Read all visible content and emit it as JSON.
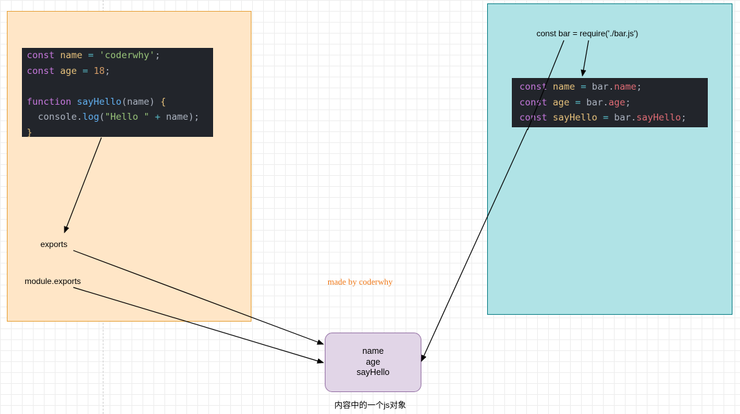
{
  "left_code": {
    "line1": {
      "kw": "const",
      "var": "name",
      "op": "=",
      "val": "'coderwhy'",
      "end": ";"
    },
    "line2": {
      "kw": "const",
      "var": "age",
      "op": "=",
      "val": "18",
      "end": ";"
    },
    "line4": {
      "kw": "function",
      "fn": "sayHello",
      "params": "(name)",
      "brace": "{"
    },
    "line5": {
      "obj": "console",
      "dot": ".",
      "method": "log",
      "open": "(",
      "str": "\"Hello \"",
      "op": "+",
      "arg": "name",
      "close": ");"
    },
    "line6": {
      "brace": "}"
    }
  },
  "right_code": {
    "line1": {
      "kw": "const",
      "var": "name",
      "op": "=",
      "obj": "bar.",
      "prop": "name",
      "end": ";"
    },
    "line2": {
      "kw": "const",
      "var": "age",
      "op": "=",
      "obj": "bar.",
      "prop": "age",
      "end": ";"
    },
    "line3": {
      "kw": "const",
      "var": "sayHello",
      "op": "=",
      "obj": "bar.",
      "prop": "sayHello",
      "end": ";"
    }
  },
  "labels": {
    "exports": "exports",
    "module_exports": "module.exports",
    "require": "const bar = require('./bar.js')",
    "watermark": "made by coderwhy",
    "object_caption": "内容中的一个js对象"
  },
  "object": {
    "props": [
      "name",
      "age",
      "sayHello"
    ]
  },
  "colors": {
    "left_panel": "#ffe6c7",
    "right_panel": "#b0e3e6",
    "object_box": "#e1d5e7",
    "watermark": "#f07c1e"
  }
}
